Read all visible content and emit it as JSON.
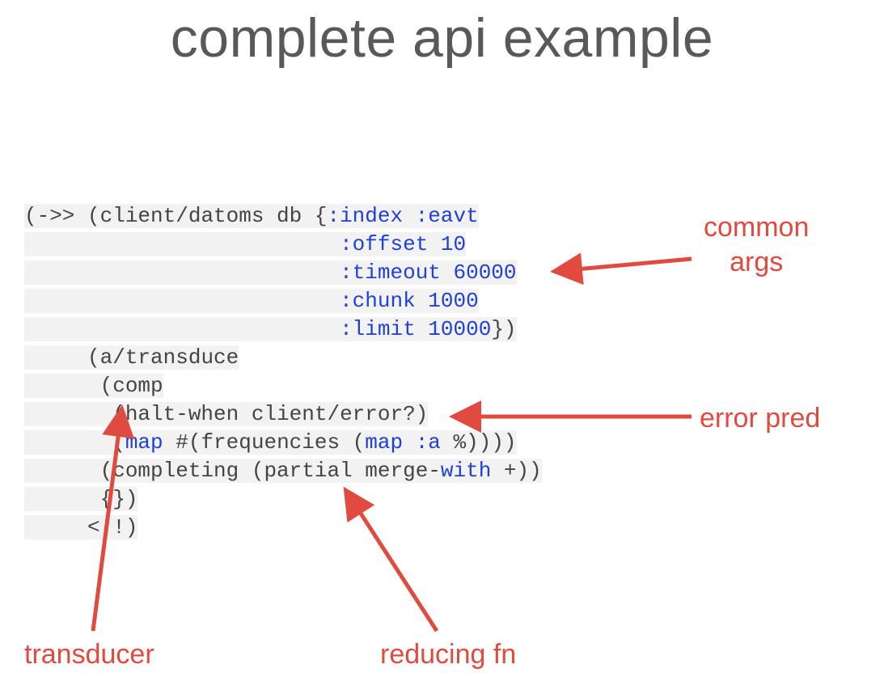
{
  "title": "complete api example",
  "code": {
    "l0a": "(->> ",
    "l0b": "(client/datoms db {",
    "l0k": ":index :eavt",
    "l1k": ":offset 10",
    "l2k": ":timeout 60000",
    "l3k": ":chunk 1000",
    "l4k": ":limit 10000",
    "l4b": "})",
    "l5a": "(a/transduce",
    "l6a": "(comp",
    "l7a": "(halt-when client/error?)",
    "l8a": "(",
    "l8b": "map",
    "l8c": " #(frequencies (",
    "l8d": "map :a",
    "l8e": " %))))",
    "l9a": "(completing (partial merge-",
    "l9b": "with",
    "l9c": " +))",
    "l10a": "{})",
    "l11a": "<!!)"
  },
  "annotations": {
    "common_args": "common\nargs",
    "error_pred": "error pred",
    "reducing_fn": "reducing fn",
    "transducer": "transducer"
  },
  "colors": {
    "annotation": "#e04a3f",
    "keyword": "#1f3fd8",
    "code_bg": "#f2f2f2",
    "title": "#595959"
  }
}
